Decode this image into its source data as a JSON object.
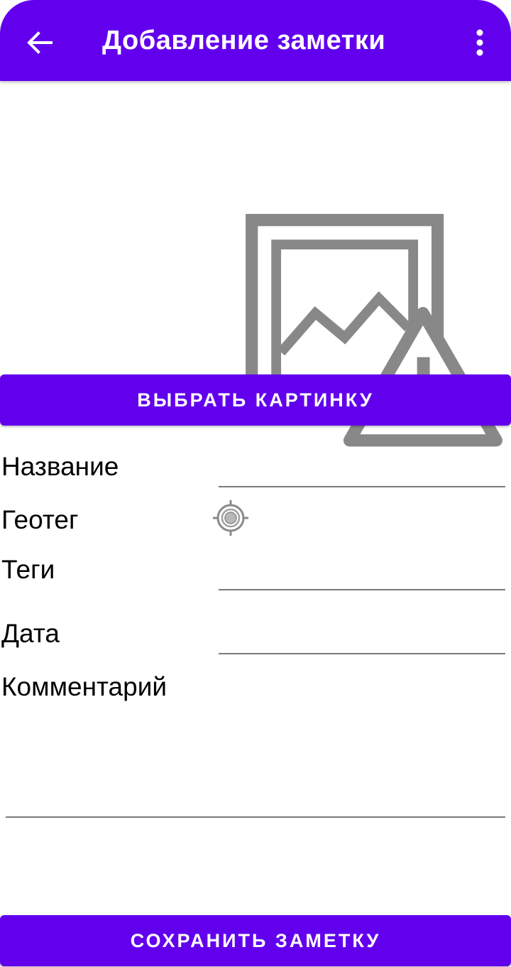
{
  "toolbar": {
    "title": "Добавление заметки",
    "back_icon": "arrow-back-icon",
    "menu_icon": "more-vert-icon",
    "background": "#6200ee"
  },
  "image": {
    "placeholder_icon": "broken-image-icon"
  },
  "buttons": {
    "pick_image": "ВЫБРАТЬ КАРТИНКУ",
    "save_note": "СОХРАНИТЬ ЗАМЕТКУ"
  },
  "form": {
    "name_label": "Название",
    "name_value": "",
    "geotag_label": "Геотег",
    "geotag_icon": "gps-target-icon",
    "tags_label": "Теги",
    "tags_value": "",
    "date_label": "Дата",
    "date_value": "",
    "comment_label": "Комментарий",
    "comment_value": ""
  },
  "colors": {
    "accent": "#6200ee",
    "underline": "#7a7a7a"
  }
}
